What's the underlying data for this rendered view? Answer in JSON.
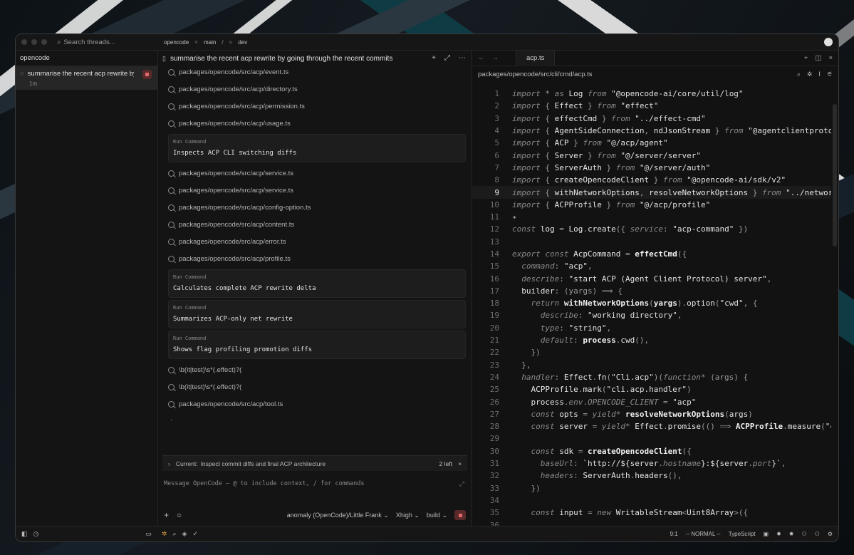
{
  "topbar": {
    "search_placeholder": "Search threads...",
    "project": "opencode",
    "branch_main": "main",
    "branch_dev": "dev"
  },
  "sidebar": {
    "title": "opencode",
    "thread": {
      "title": "summarise the recent acp rewrite by",
      "time": "1m"
    }
  },
  "chat": {
    "title": "summarise the recent acp rewrite by going through the recent commits",
    "feed": [
      {
        "type": "file",
        "text": "packages/opencode/src/acp/event.ts"
      },
      {
        "type": "file",
        "text": "packages/opencode/src/acp/directory.ts"
      },
      {
        "type": "file",
        "text": "packages/opencode/src/acp/permission.ts"
      },
      {
        "type": "file",
        "text": "packages/opencode/src/acp/usage.ts"
      },
      {
        "type": "cmd",
        "label": "Run Command",
        "text": "Inspects ACP CLI switching diffs"
      },
      {
        "type": "file",
        "text": "packages/opencode/src/acp/service.ts"
      },
      {
        "type": "file",
        "text": "packages/opencode/src/acp/service.ts"
      },
      {
        "type": "file",
        "text": "packages/opencode/src/acp/config-option.ts"
      },
      {
        "type": "file",
        "text": "packages/opencode/src/acp/content.ts"
      },
      {
        "type": "file",
        "text": "packages/opencode/src/acp/error.ts"
      },
      {
        "type": "file",
        "text": "packages/opencode/src/acp/profile.ts"
      },
      {
        "type": "cmd",
        "label": "Run Command",
        "text": "Calculates complete ACP rewrite delta"
      },
      {
        "type": "cmd",
        "label": "Run Command",
        "text": "Summarizes ACP-only net rewrite"
      },
      {
        "type": "cmd",
        "label": "Run Command",
        "text": "Shows flag profiling promotion diffs"
      },
      {
        "type": "file",
        "text": "\\b(it|test)\\s*(.effect)?("
      },
      {
        "type": "file",
        "text": "\\b(it|test)\\s*(.effect)?("
      },
      {
        "type": "file",
        "text": "packages/opencode/src/acp/tool.ts"
      }
    ],
    "current_label": "Current:",
    "current_text": "Inspect commit diffs and final ACP architecture",
    "left_count": "2 left",
    "message_placeholder": "Message OpenCode — @ to include context, / for commands",
    "model": "anomaly (OpenCode)/Little Frank",
    "effort": "Xhigh",
    "mode": "build"
  },
  "editor": {
    "tab": "acp.ts",
    "path": "packages/opencode/src/cli/cmd/acp.ts",
    "current_line": 9
  },
  "status": {
    "position": "9:1",
    "mode": "-- NORMAL --",
    "language": "TypeScript"
  }
}
